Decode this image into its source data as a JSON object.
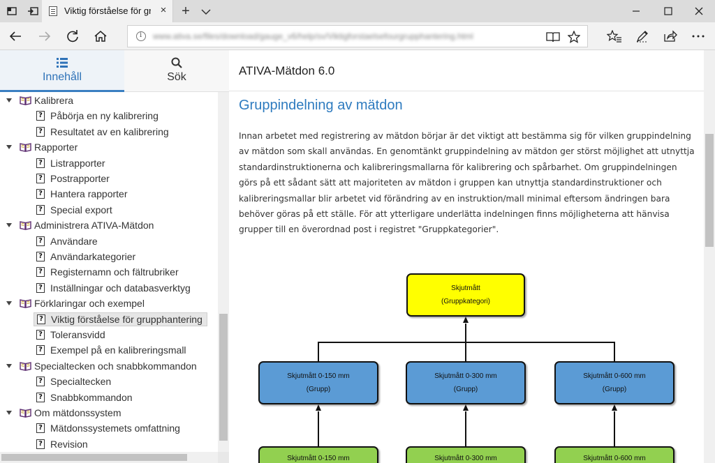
{
  "browser": {
    "tab_title": "Viktig förståelse för gru",
    "url": "www.ativa.se/files/download/gauge_v6/help/sv/Viktigforstaelsefourgrupphantering.html",
    "new_tab_label": "+",
    "close_tab_label": "×"
  },
  "toc_tabs": {
    "contents_label": "Innehåll",
    "search_label": "Sök"
  },
  "toc": [
    {
      "label": "Kalibrera",
      "type": "book",
      "level": 0
    },
    {
      "label": "Påbörja en ny kalibrering",
      "type": "topic",
      "level": 1
    },
    {
      "label": "Resultatet av en kalibrering",
      "type": "topic",
      "level": 1
    },
    {
      "label": "Rapporter",
      "type": "book",
      "level": 0
    },
    {
      "label": "Listrapporter",
      "type": "topic",
      "level": 1
    },
    {
      "label": "Postrapporter",
      "type": "topic",
      "level": 1
    },
    {
      "label": "Hantera rapporter",
      "type": "topic",
      "level": 1
    },
    {
      "label": "Special export",
      "type": "topic",
      "level": 1
    },
    {
      "label": "Administrera ATIVA-Mätdon",
      "type": "book",
      "level": 0
    },
    {
      "label": "Användare",
      "type": "topic",
      "level": 1
    },
    {
      "label": "Användarkategorier",
      "type": "topic",
      "level": 1
    },
    {
      "label": "Registernamn och fältrubriker",
      "type": "topic",
      "level": 1
    },
    {
      "label": "Inställningar och databasverktyg",
      "type": "topic",
      "level": 1
    },
    {
      "label": "Förklaringar och exempel",
      "type": "book",
      "level": 0
    },
    {
      "label": "Viktig förståelse för grupphantering",
      "type": "topic",
      "level": 1,
      "selected": true
    },
    {
      "label": "Toleransvidd",
      "type": "topic",
      "level": 1
    },
    {
      "label": "Exempel på en kalibreringsmall",
      "type": "topic",
      "level": 1
    },
    {
      "label": "Specialtecken och snabbkommandon",
      "type": "book",
      "level": 0
    },
    {
      "label": "Specialtecken",
      "type": "topic",
      "level": 1
    },
    {
      "label": "Snabbkommandon",
      "type": "topic",
      "level": 1
    },
    {
      "label": "Om mätdonssystem",
      "type": "book",
      "level": 0
    },
    {
      "label": "Mätdonssystemets omfattning",
      "type": "topic",
      "level": 1
    },
    {
      "label": "Revision",
      "type": "topic",
      "level": 1
    }
  ],
  "content": {
    "header_title": "ATIVA-Mätdon 6.0",
    "heading": "Gruppindelning av mätdon",
    "paragraph": "Innan arbetet med registrering av mätdon börjar är det viktigt att bestämma sig för vilken gruppindelning av mätdon som skall användas. En genomtänkt gruppindelning av mätdon ger störst möjlighet att utnyttja standardinstruktionerna och kalibreringsmallarna för kalibrering och spårbarhet. Om gruppindelningen görs på ett sådant sätt att majoriteten av mätdon i gruppen kan utnyttja standardinstruktioner och kalibreringsmallar blir arbetet vid förändring av en instruktion/mall minimal eftersom ändringen bara behöver göras på ett ställe. För att ytterligare underlätta indelningen finns möjligheterna att hänvisa grupper till en överordnad post i registret \"Gruppkategorier\"."
  },
  "org_chart": {
    "category": {
      "line1": "Skjutmått",
      "line2": "(Gruppkategori)",
      "color": "#ffff00"
    },
    "groups": [
      {
        "line1": "Skjutmått 0-150 mm",
        "line2": "(Grupp)",
        "color": "#5b9bd5"
      },
      {
        "line1": "Skjutmått 0-300 mm",
        "line2": "(Grupp)",
        "color": "#5b9bd5"
      },
      {
        "line1": "Skjutmått 0-600 mm",
        "line2": "(Grupp)",
        "color": "#5b9bd5"
      }
    ],
    "items": [
      {
        "line1": "Skjutmått 0-150 mm",
        "color": "#92d050"
      },
      {
        "line1": "Skjutmått 0-300 mm",
        "color": "#92d050"
      },
      {
        "line1": "Skjutmått 0-600 mm",
        "color": "#92d050"
      }
    ]
  },
  "colors": {
    "accent": "#2e7bbf",
    "tab_underline": "#3a7fc1"
  }
}
